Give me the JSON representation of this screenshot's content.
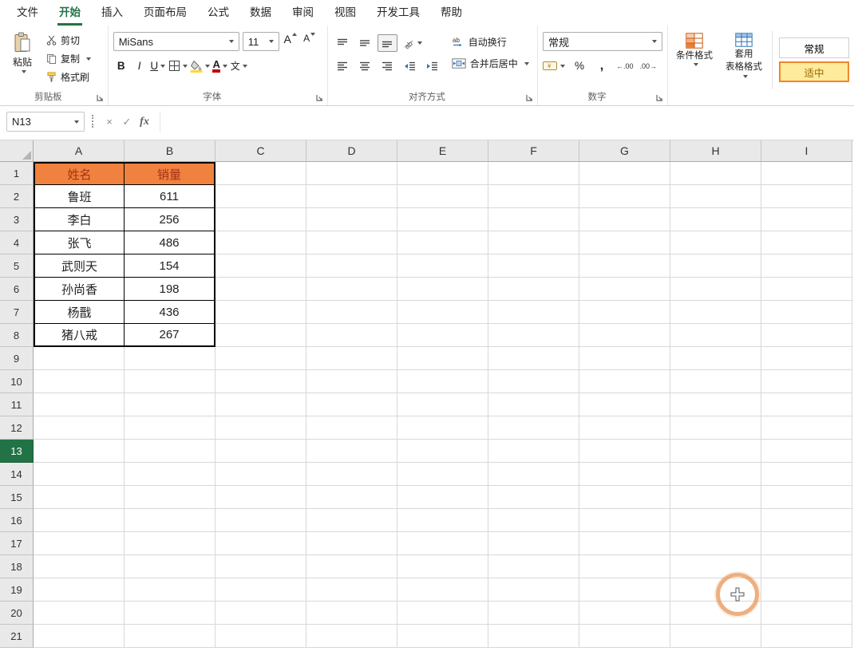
{
  "menu": {
    "tabs": [
      {
        "name": "file",
        "label": "文件"
      },
      {
        "name": "home",
        "label": "开始"
      },
      {
        "name": "insert",
        "label": "插入"
      },
      {
        "name": "page-layout",
        "label": "页面布局"
      },
      {
        "name": "formulas",
        "label": "公式"
      },
      {
        "name": "data",
        "label": "数据"
      },
      {
        "name": "review",
        "label": "审阅"
      },
      {
        "name": "view",
        "label": "视图"
      },
      {
        "name": "developer",
        "label": "开发工具"
      },
      {
        "name": "help",
        "label": "帮助"
      }
    ],
    "active_tab": "home"
  },
  "ribbon": {
    "clipboard": {
      "label": "剪贴板",
      "paste": "粘贴",
      "cut": "剪切",
      "copy": "复制",
      "format_painter": "格式刷"
    },
    "font": {
      "label": "字体",
      "font_name": "MiSans",
      "font_size": "11",
      "bold": "B",
      "italic": "I",
      "underline": "U",
      "grow_font": "A",
      "shrink_font": "A",
      "phonetic": "文"
    },
    "alignment": {
      "label": "对齐方式",
      "wrap_text": "自动换行",
      "merge_center": "合并后居中"
    },
    "number": {
      "label": "数字",
      "format": "常规",
      "currency_symbol": "¥",
      "percent": "%",
      "comma": ",",
      "inc_decimal": "←.00",
      "dec_decimal": ".00→"
    },
    "styles": {
      "conditional": "条件格式",
      "format_table_line1": "套用",
      "format_table_line2": "表格格式",
      "cell_styles": [
        {
          "label": "常规",
          "bg": "#FFFFFF",
          "fg": "#000000",
          "selected": false
        },
        {
          "label": "适中",
          "bg": "#FFEB9C",
          "fg": "#9C6500",
          "selected": true
        }
      ]
    }
  },
  "formula_bar": {
    "name_box": "N13",
    "cancel": "×",
    "enter": "✓",
    "fx": "fx",
    "value": ""
  },
  "sheet": {
    "columns": [
      "A",
      "B",
      "C",
      "D",
      "E",
      "F",
      "G",
      "H",
      "I"
    ],
    "row_count": 21,
    "active_row": 13,
    "table": {
      "header": [
        "姓名",
        "销量"
      ],
      "header_bg": "#F0813E",
      "header_fg": "#A43117",
      "rows": [
        [
          "鲁班",
          "611"
        ],
        [
          "李白",
          "256"
        ],
        [
          "张飞",
          "486"
        ],
        [
          "武则天",
          "154"
        ],
        [
          "孙尚香",
          "198"
        ],
        [
          "杨戬",
          "436"
        ],
        [
          "猪八戒",
          "267"
        ]
      ]
    }
  },
  "colors": {
    "accent_green": "#217346",
    "grid_line": "#D8D8D8",
    "header_bg": "#E9E9E9"
  }
}
